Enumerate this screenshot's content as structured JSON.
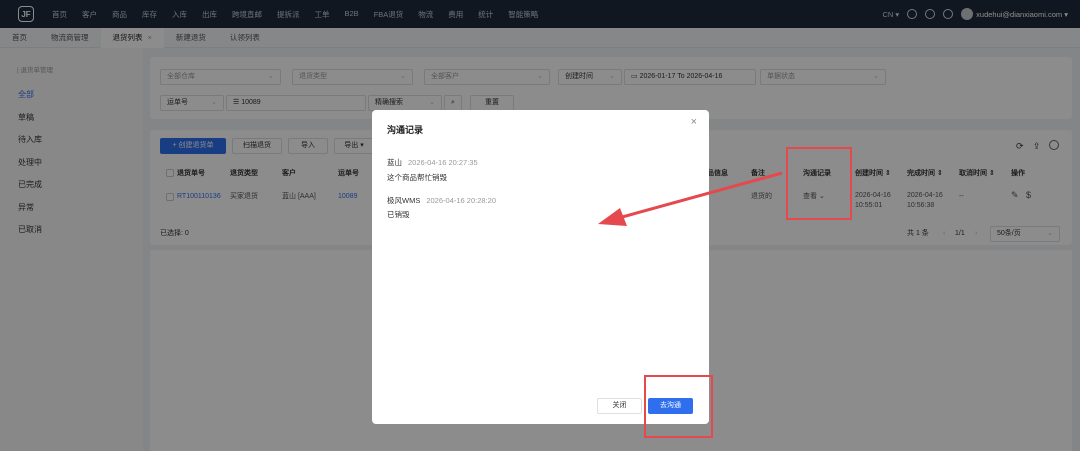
{
  "logo": "JF",
  "nav": [
    "首页",
    "客户",
    "商品",
    "库存",
    "入库",
    "出库",
    "跨境直邮",
    "提拆派",
    "工单",
    "B2B",
    "FBA退货",
    "物流",
    "费用",
    "统计",
    "智能策略"
  ],
  "nav_right": {
    "lang": "CN ▾",
    "user": "xudehui@dianxiaomi.com ▾"
  },
  "tabs": [
    {
      "label": "首页"
    },
    {
      "label": "物流商管理"
    },
    {
      "label": "退货列表",
      "close": "×"
    },
    {
      "label": "新建退货"
    },
    {
      "label": "认领列表"
    }
  ],
  "sidebar": {
    "title": "| 退货单管理",
    "items": [
      "全部",
      "草稿",
      "待入库",
      "处理中",
      "已完成",
      "异常",
      "已取消"
    ]
  },
  "filters": {
    "warehouse": "全部仓库",
    "return_type": "退货类型",
    "customer": "全部客户",
    "time_type": "创建时间",
    "date_from": "2026-01-17",
    "date_to_label": "To",
    "date_to": "2026-04-16",
    "status": "单据状态",
    "field": "运单号",
    "field_value": "10089",
    "match": "精确搜索",
    "reset": "重置",
    "date_icon": "▭",
    "search_icon": "⌕",
    "list_icon": "☰"
  },
  "toolbar": {
    "create": "+ 创建退货单",
    "scan": "扫描退货",
    "import": "导入",
    "export": "导出 ▾"
  },
  "table": {
    "headers": {
      "return_no": "退货单号",
      "return_type": "退货类型",
      "customer": "客户",
      "waybill": "运单号",
      "product_info": "品信息",
      "remark": "备注",
      "comm": "沟通记录",
      "created": "创建时间 ⇕",
      "completed": "完成时间 ⇕",
      "cancelled": "取消时间 ⇕",
      "ops": "操作"
    },
    "row": {
      "return_no": "RT100110136",
      "return_type": "买家退货",
      "customer": "蓝山 [AAA]",
      "waybill": "10089",
      "remark": "退货的",
      "comm": "查看 ⌄",
      "created_date": "2026-04-16",
      "created_time": "10:55:01",
      "completed_date": "2026-04-16",
      "completed_time": "10:56:38",
      "cancelled": "--"
    },
    "selected": "已选择: 0",
    "total": "共 1 条",
    "page": "1/1",
    "prev": "‹",
    "next": "›",
    "page_size": "50条/页"
  },
  "modal": {
    "title": "沟通记录",
    "close": "×",
    "messages": [
      {
        "author": "蓝山",
        "time": "2026-04-16 20:27:35",
        "text": "这个商品帮忙销毁"
      },
      {
        "author": "极风WMS",
        "time": "2026-04-16 20:28:20",
        "text": "已销毁"
      }
    ],
    "cancel": "关闭",
    "confirm": "去沟通"
  },
  "colors": {
    "accent": "#2f6fed",
    "highlight": "#e5484d",
    "nav_bg": "#1f2a3c"
  }
}
